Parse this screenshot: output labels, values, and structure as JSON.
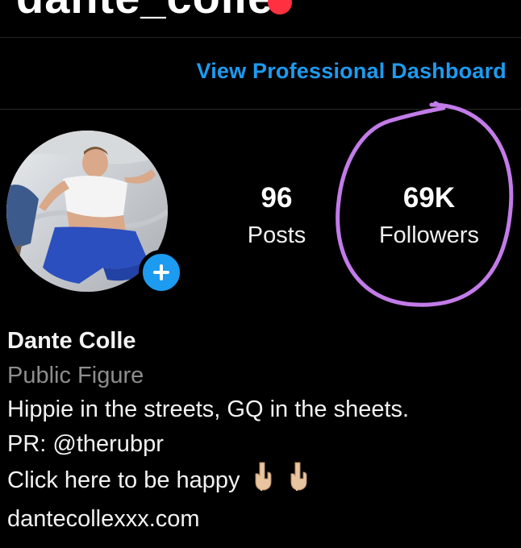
{
  "header": {
    "username": "dante_colle",
    "notification_color": "#ff3040"
  },
  "professional": {
    "dashboard_link": "View Professional Dashboard",
    "link_color": "#1d9bf0"
  },
  "profile": {
    "avatar_alt_icon": "profile-photo",
    "add_story_icon": "plus-icon",
    "stats": [
      {
        "value": "96",
        "label": "Posts"
      },
      {
        "value": "69K",
        "label": "Followers"
      }
    ],
    "annotation_color": "#c27be8"
  },
  "bio": {
    "name": "Dante Colle",
    "category": "Public Figure",
    "lines": [
      "Hippie in the streets, GQ in the sheets.",
      "PR: @therubpr",
      "Click here to be happy"
    ],
    "link": "dantecollexxx.com"
  }
}
